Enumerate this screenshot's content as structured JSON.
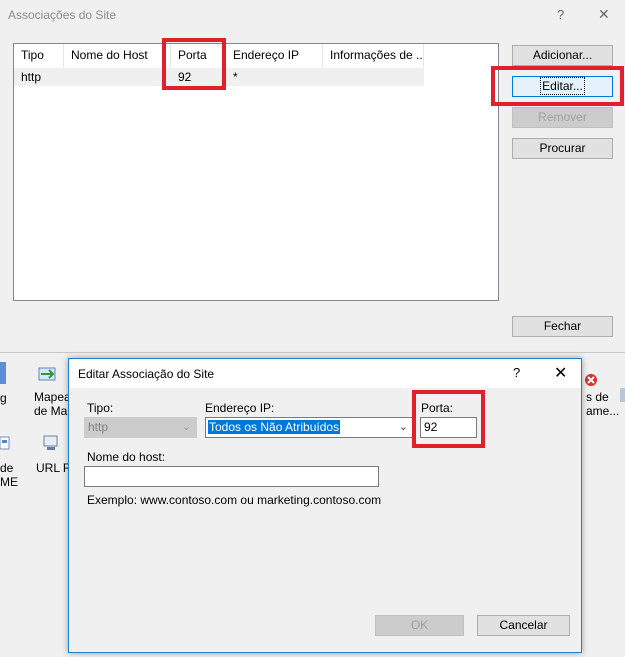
{
  "back_dialog": {
    "title": "Associações do Site",
    "help_glyph": "?",
    "close_glyph": "✕",
    "columns": [
      "Tipo",
      "Nome do Host",
      "Porta",
      "Endereço IP",
      "Informações de ..."
    ],
    "rows": [
      {
        "tipo": "http",
        "host": "",
        "porta": "92",
        "ip": "*",
        "info": ""
      }
    ],
    "buttons": {
      "add": "Adicionar...",
      "edit": "Editar...",
      "remove": "Remover",
      "browse": "Procurar",
      "close": "Fechar"
    }
  },
  "background_features": {
    "left_cut_1": "g",
    "mapea_1": "Mapea",
    "mapea_2": "de Ma",
    "left_cut_2a": "de",
    "left_cut_2b": "ME",
    "url_re": "URL Re",
    "right_1": "s de",
    "right_2": "ame..."
  },
  "front_dialog": {
    "title": "Editar Associação do Site",
    "help_glyph": "?",
    "close_glyph": "✕",
    "type_label": "Tipo:",
    "type_value": "http",
    "ip_label": "Endereço IP:",
    "ip_value": "Todos os Não Atribuídos",
    "port_label": "Porta:",
    "port_value": "92",
    "host_label": "Nome do host:",
    "host_value": "",
    "example": "Exemplo: www.contoso.com ou marketing.contoso.com",
    "ok": "OK",
    "cancel": "Cancelar"
  },
  "annotation_color": "#e0202a"
}
